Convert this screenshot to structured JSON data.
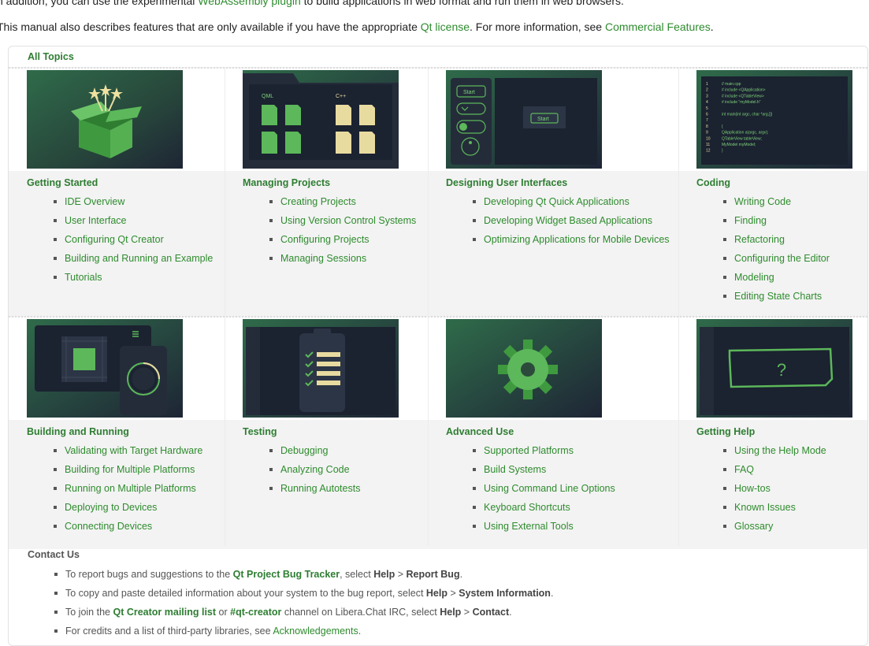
{
  "intro": {
    "line1_pre": "n addition, you can use the experimental ",
    "line1_link": "WebAssembly plugin",
    "line1_post": " to build applications in web format and run them in web browsers.",
    "line2_pre": "This manual also describes features that are only available if you have the appropriate ",
    "line2_link1": "Qt license",
    "line2_mid": ". For more information, see ",
    "line2_link2": "Commercial Features",
    "line2_post": "."
  },
  "all_topics": "All Topics",
  "topics": [
    {
      "title": "Getting Started",
      "items": [
        "IDE Overview",
        "User Interface",
        "Configuring Qt Creator",
        "Building and Running an Example",
        "Tutorials"
      ]
    },
    {
      "title": "Managing Projects",
      "items": [
        "Creating Projects",
        "Using Version Control Systems",
        "Configuring Projects",
        "Managing Sessions"
      ]
    },
    {
      "title": "Designing User Interfaces",
      "items": [
        "Developing Qt Quick Applications",
        "Developing Widget Based Applications",
        "Optimizing Applications for Mobile Devices"
      ]
    },
    {
      "title": "Coding",
      "items": [
        "Writing Code",
        "Finding",
        "Refactoring",
        "Configuring the Editor",
        "Modeling",
        "Editing State Charts"
      ]
    },
    {
      "title": "Building and Running",
      "items": [
        "Validating with Target Hardware",
        "Building for Multiple Platforms",
        "Running on Multiple Platforms",
        "Deploying to Devices",
        "Connecting Devices"
      ]
    },
    {
      "title": "Testing",
      "items": [
        "Debugging",
        "Analyzing Code",
        "Running Autotests"
      ]
    },
    {
      "title": "Advanced Use",
      "items": [
        "Supported Platforms",
        "Build Systems",
        "Using Command Line Options",
        "Keyboard Shortcuts",
        "Using External Tools"
      ]
    },
    {
      "title": "Getting Help",
      "items": [
        "Using the Help Mode",
        "FAQ",
        "How-tos",
        "Known Issues",
        "Glossary"
      ]
    }
  ],
  "images": {
    "projects": {
      "qml": "QML",
      "cpp": "C++"
    },
    "ui": {
      "start_btn": "Start",
      "start_btn2": "Start"
    },
    "code_lines": [
      [
        "1",
        "// main.cpp"
      ],
      [
        "2",
        "# include <QApplication>"
      ],
      [
        "3",
        "# include <QTableView>"
      ],
      [
        "4",
        "# include \"myModel.h\""
      ],
      [
        "5",
        ""
      ],
      [
        "6",
        "int main(int argc, char *arg,[])"
      ],
      [
        "7",
        ""
      ],
      [
        "8",
        "{"
      ],
      [
        "9",
        "QApplication a(argc, argv);"
      ],
      [
        "10",
        "QTableView tableView;"
      ],
      [
        "11",
        "MyModel myModel;"
      ],
      [
        "12",
        "}"
      ]
    ],
    "help": {
      "symbol": "?"
    }
  },
  "contact": {
    "title": "Contact Us",
    "l1_pre": "To report bugs and suggestions to the ",
    "l1_link": "Qt Project Bug Tracker",
    "l1_mid": ", select ",
    "l1_b1": "Help",
    "l1_gt": " > ",
    "l1_b2": "Report Bug",
    "l1_post": ".",
    "l2_pre": "To copy and paste detailed information about your system to the bug report, select ",
    "l2_b1": "Help",
    "l2_gt": " > ",
    "l2_b2": "System Information",
    "l2_post": ".",
    "l3_pre": "To join the ",
    "l3_link1": "Qt Creator mailing list",
    "l3_mid1": " or ",
    "l3_link2": "#qt-creator",
    "l3_mid2": " channel on Libera.Chat IRC, select ",
    "l3_b1": "Help",
    "l3_gt": " > ",
    "l3_b2": "Contact",
    "l3_post": ".",
    "l4_pre": "For credits and a list of third-party libraries, see ",
    "l4_link": "Acknowledgements",
    "l4_post": "."
  }
}
